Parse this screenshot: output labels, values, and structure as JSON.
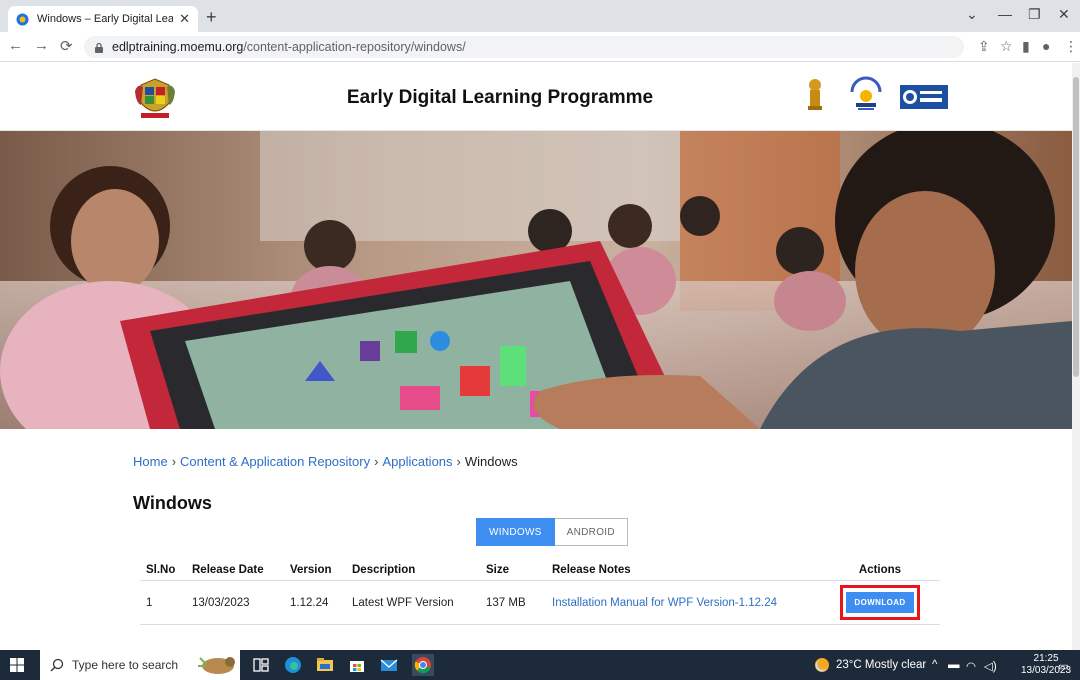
{
  "browser": {
    "tab_title": "Windows – Early Digital Learning",
    "url_host": "edlptraining.moemu.org",
    "url_path": "/content-application-repository/windows/"
  },
  "site": {
    "title": "Early Digital Learning Programme",
    "logos": [
      "mauritius-coat-of-arms-logo",
      "india-emblem-logo",
      "ministry-logo",
      "edcil-logo"
    ]
  },
  "breadcrumb": {
    "items": [
      "Home",
      "Content & Application Repository",
      "Applications"
    ],
    "current": "Windows",
    "separator": "›"
  },
  "page": {
    "heading": "Windows",
    "toggle": {
      "active": "WINDOWS",
      "inactive": "ANDROID"
    }
  },
  "table": {
    "headers": [
      "Sl.No",
      "Release Date",
      "Version",
      "Description",
      "Size",
      "Release Notes",
      "Actions"
    ],
    "rows": [
      {
        "sl_no": "1",
        "release_date": "13/03/2023",
        "version": "1.12.24",
        "description": "Latest WPF Version",
        "size": "137 MB",
        "release_notes": "Installation Manual for WPF Version-1.12.24",
        "action": "DOWNLOAD"
      }
    ]
  },
  "taskbar": {
    "search_placeholder": "Type here to search",
    "weather": "23°C  Mostly clear",
    "time": "21:25",
    "date": "13/03/2023"
  },
  "colors": {
    "accent": "#3d8ef0",
    "link": "#2e6fc4",
    "highlight": "#e8141b",
    "taskbar": "#1d2a3a"
  }
}
